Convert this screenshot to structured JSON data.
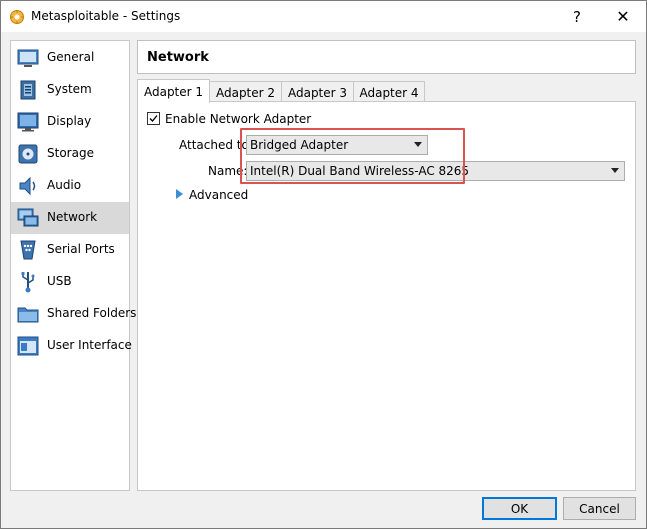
{
  "window": {
    "title": "Metasploitable - Settings",
    "help_glyph": "?",
    "close_glyph": "✕"
  },
  "sidebar": {
    "items": [
      {
        "label": "General",
        "icon": "general-icon"
      },
      {
        "label": "System",
        "icon": "system-icon"
      },
      {
        "label": "Display",
        "icon": "display-icon"
      },
      {
        "label": "Storage",
        "icon": "storage-icon"
      },
      {
        "label": "Audio",
        "icon": "audio-icon"
      },
      {
        "label": "Network",
        "icon": "network-icon",
        "selected": true
      },
      {
        "label": "Serial Ports",
        "icon": "serial-ports-icon"
      },
      {
        "label": "USB",
        "icon": "usb-icon"
      },
      {
        "label": "Shared Folders",
        "icon": "shared-folders-icon"
      },
      {
        "label": "User Interface",
        "icon": "user-interface-icon"
      }
    ]
  },
  "header": {
    "title": "Network"
  },
  "tabs": [
    {
      "label": "Adapter 1",
      "active": true
    },
    {
      "label": "Adapter 2"
    },
    {
      "label": "Adapter 3"
    },
    {
      "label": "Adapter 4"
    }
  ],
  "adapter": {
    "enable_label": "Enable Network Adapter",
    "enable_checked": true,
    "attached_label": "Attached to:",
    "attached_value": "Bridged Adapter",
    "name_label": "Name:",
    "name_value": "Intel(R) Dual Band Wireless-AC 8265",
    "advanced_label": "Advanced"
  },
  "footer": {
    "ok_label": "OK",
    "cancel_label": "Cancel"
  },
  "colors": {
    "highlight": "#d9534f",
    "selection": "#d9d9d9",
    "default_button": "#0078d7"
  }
}
